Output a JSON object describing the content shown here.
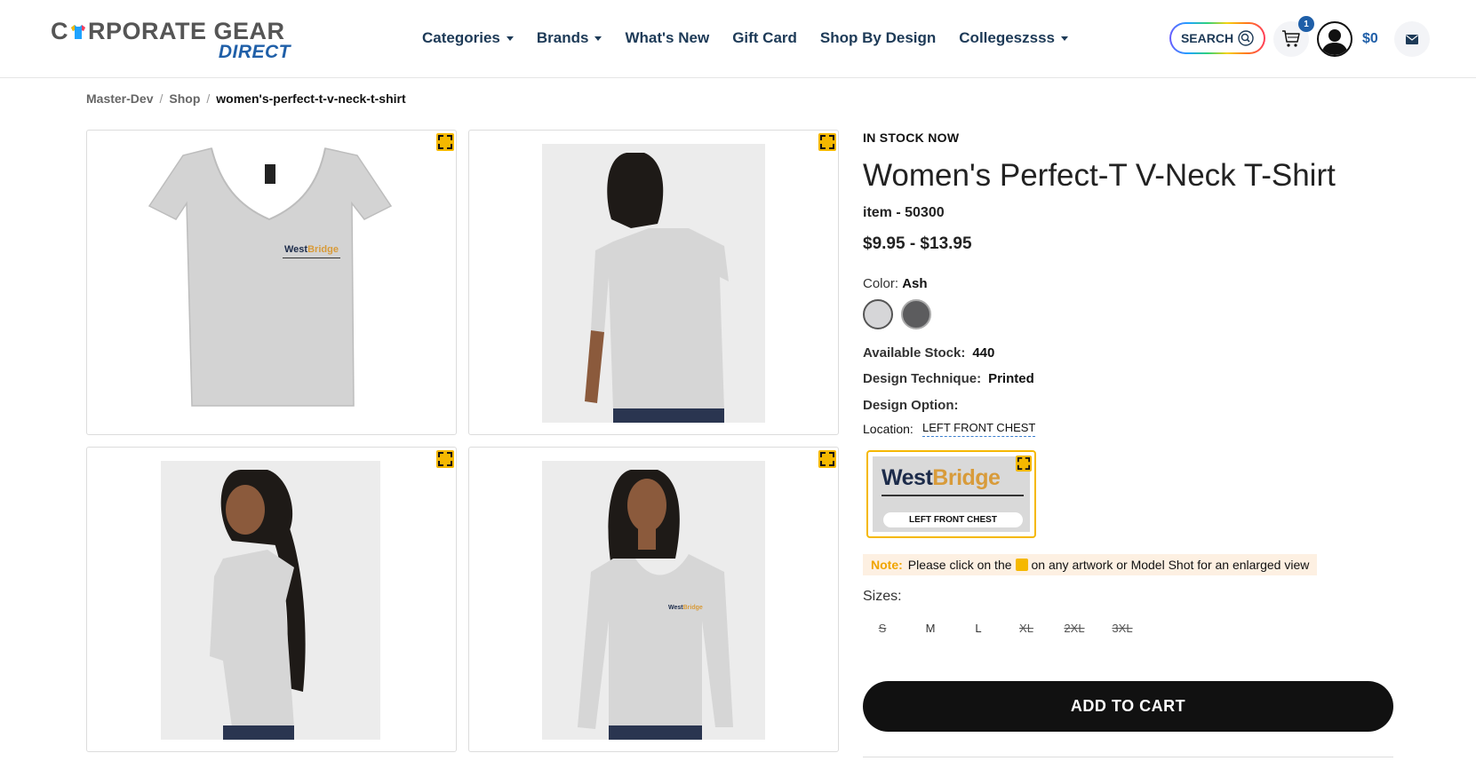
{
  "brand": {
    "logo_top_a": "C",
    "logo_top_b": "RPORATE GEAR",
    "logo_bottom": "DIRECT"
  },
  "nav": {
    "categories": "Categories",
    "brands": "Brands",
    "whats_new": "What's New",
    "gift_card": "Gift Card",
    "shop_by_design": "Shop By Design",
    "colleges": "Collegeszsss"
  },
  "header": {
    "search_label": "SEARCH",
    "cart_count": "1",
    "cart_total": "$0"
  },
  "breadcrumb": {
    "root": "Master-Dev",
    "shop": "Shop",
    "current": "women's-perfect-t-v-neck-t-shirt",
    "separator": "/"
  },
  "product": {
    "stock_heading": "IN STOCK NOW",
    "title": "Women's Perfect-T V-Neck T-Shirt",
    "sku": "item - 50300",
    "price": "$9.95 - $13.95",
    "color_label": "Color:",
    "color_value": "Ash",
    "swatches": [
      {
        "name": "Ash",
        "color": "#d6d6d8",
        "selected": true
      },
      {
        "name": "Charcoal",
        "color": "#5c5c5e",
        "selected": false
      }
    ],
    "available_label": "Available Stock:",
    "available_value": "440",
    "technique_label": "Design Technique:",
    "technique_value": "Printed",
    "design_option_label": "Design Option:",
    "location_label": "Location:",
    "location_value": "LEFT FRONT CHEST",
    "design_card": {
      "brand_a": "West",
      "brand_b": "Bridge",
      "tag": "LEFT FRONT CHEST"
    },
    "note_label": "Note:",
    "note_text_a": "Please click on the",
    "note_text_b": "on any artwork or Model Shot for an enlarged view",
    "sizes_label": "Sizes:",
    "sizes": [
      {
        "label": "S",
        "available": false
      },
      {
        "label": "M",
        "available": true
      },
      {
        "label": "L",
        "available": true
      },
      {
        "label": "XL",
        "available": false
      },
      {
        "label": "2XL",
        "available": false
      },
      {
        "label": "3XL",
        "available": false
      }
    ],
    "add_to_cart": "ADD TO CART"
  },
  "gallery": {
    "shirt_logo_a": "West",
    "shirt_logo_b": "Bridge"
  },
  "colors": {
    "accent_blue": "#1f5fa8",
    "expand_yellow": "#f5b800",
    "nav_text": "#1d3a57"
  }
}
